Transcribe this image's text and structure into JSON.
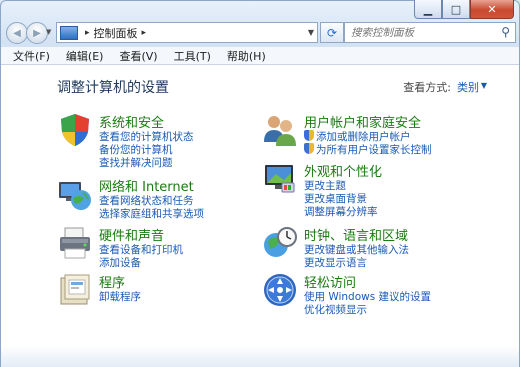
{
  "titlebar": {
    "minimize_icon": "minimize-icon",
    "maximize_icon": "maximize-icon",
    "close_icon": "close-icon"
  },
  "nav": {
    "address_parts": [
      "控制面板"
    ],
    "search_placeholder": "搜索控制面板"
  },
  "menu": [
    "文件(F)",
    "编辑(E)",
    "查看(V)",
    "工具(T)",
    "帮助(H)"
  ],
  "page": {
    "title": "调整计算机的设置",
    "view_by_label": "查看方式:",
    "view_by_value": "类别"
  },
  "categories": [
    {
      "title": "系统和安全",
      "links": [
        "查看您的计算机状态",
        "备份您的计算机",
        "查找并解决问题"
      ]
    },
    {
      "title": "网络和 Internet",
      "links": [
        "查看网络状态和任务",
        "选择家庭组和共享选项"
      ]
    },
    {
      "title": "硬件和声音",
      "links": [
        "查看设备和打印机",
        "添加设备"
      ]
    },
    {
      "title": "程序",
      "links": [
        "卸载程序"
      ]
    },
    {
      "title": "用户帐户和家庭安全",
      "links": [
        "添加或删除用户帐户",
        "为所有用户设置家长控制"
      ]
    },
    {
      "title": "外观和个性化",
      "links": [
        "更改主题",
        "更改桌面背景",
        "调整屏幕分辨率"
      ]
    },
    {
      "title": "时钟、语言和区域",
      "links": [
        "更改键盘或其他输入法",
        "更改显示语言"
      ]
    },
    {
      "title": "轻松访问",
      "links": [
        "使用 Windows 建议的设置",
        "优化视频显示"
      ]
    }
  ]
}
